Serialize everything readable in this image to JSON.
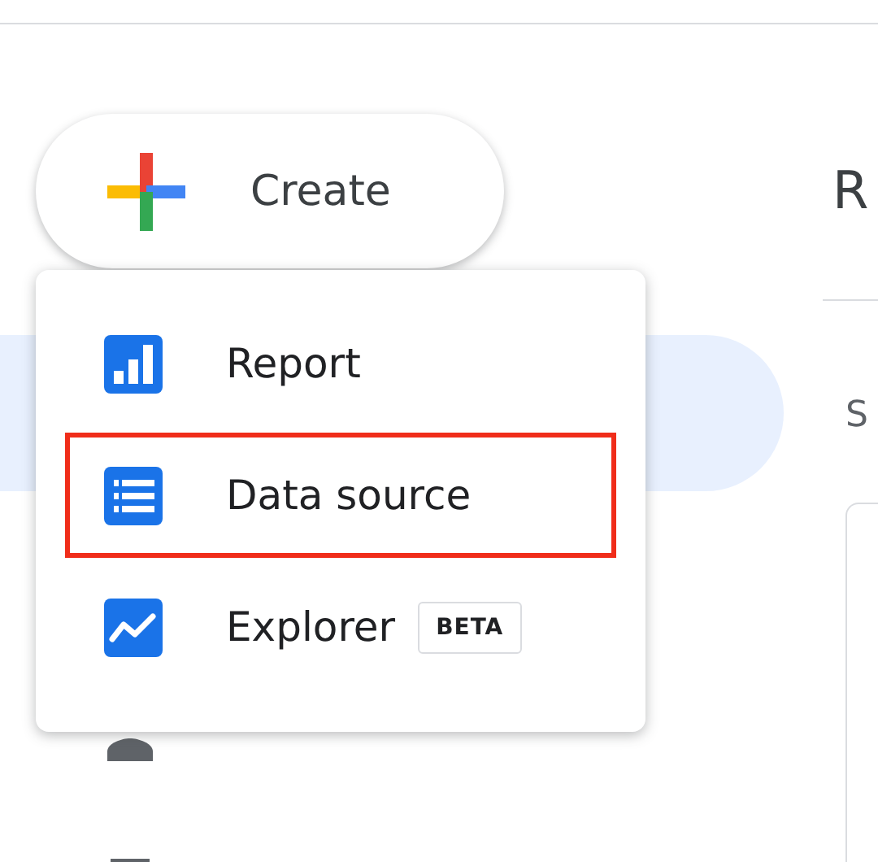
{
  "create_button": {
    "label": "Create"
  },
  "sidebar": {
    "highlighted_item": true
  },
  "create_menu": {
    "items": [
      {
        "label": "Report",
        "kind": "report",
        "highlighted": false
      },
      {
        "label": "Data source",
        "kind": "source",
        "highlighted": true
      },
      {
        "label": "Explorer",
        "kind": "explorer",
        "highlighted": false,
        "badge": "BETA"
      }
    ]
  },
  "main": {
    "heading": "R",
    "subheading": "S"
  }
}
